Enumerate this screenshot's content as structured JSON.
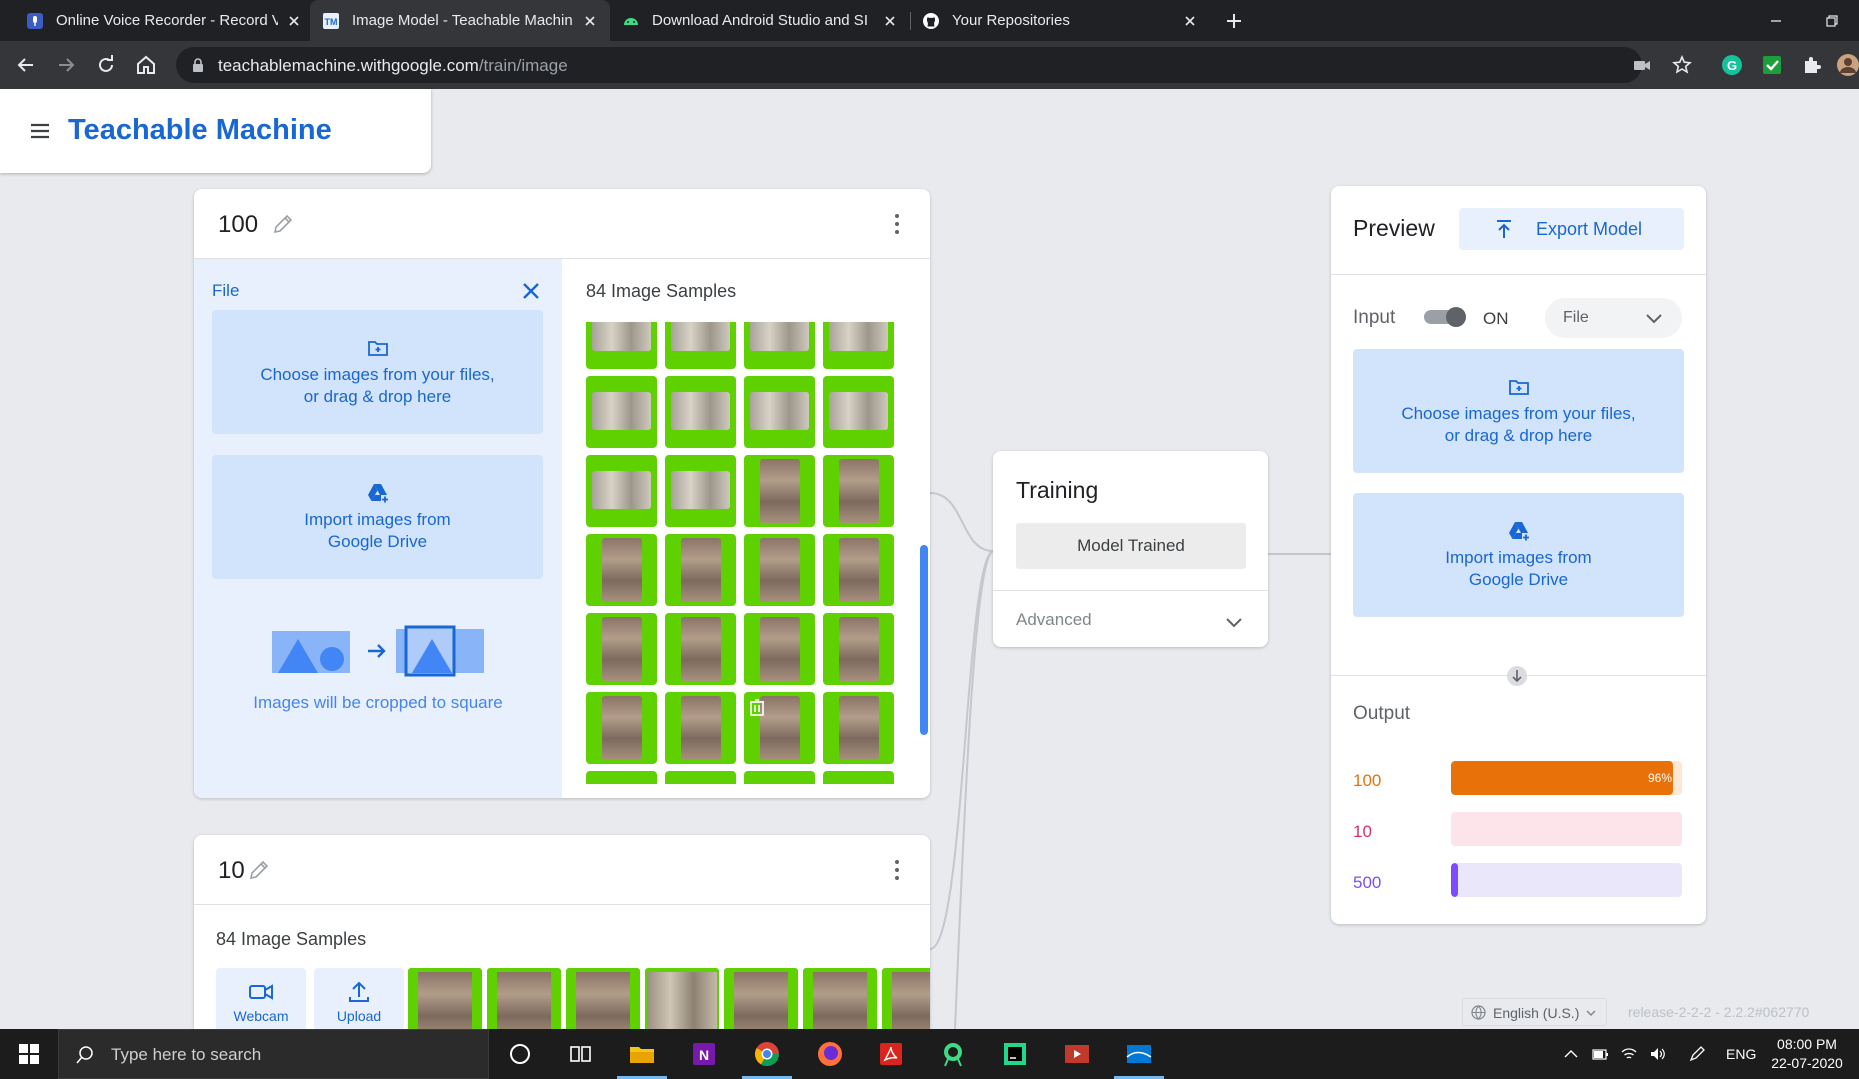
{
  "browser": {
    "tabs": [
      {
        "title": "Online Voice Recorder - Record V",
        "icon": "voice-recorder-icon",
        "color": "#3b5cc4"
      },
      {
        "title": "Image Model - Teachable Machin",
        "icon": "teachable-machine-icon",
        "color": "#4285f4",
        "active": true
      },
      {
        "title": "Download Android Studio and SI",
        "icon": "android-icon",
        "color": "#3ddc84"
      },
      {
        "title": "Your Repositories",
        "icon": "github-icon",
        "color": "#ffffff"
      }
    ],
    "url_host": "teachablemachine.withgoogle.com",
    "url_path": "/train/image"
  },
  "app": {
    "title": "Teachable Machine",
    "accent": "#1967d2"
  },
  "class1": {
    "name": "100",
    "upload_panel": {
      "label": "File",
      "choose_line1": "Choose images from your files,",
      "choose_line2": "or drag & drop here",
      "drive_line1": "Import images from",
      "drive_line2": "Google Drive",
      "crop_note": "Images will be cropped to square"
    },
    "samples_title": "84 Image Samples"
  },
  "class2": {
    "name": "10",
    "samples_title": "84 Image Samples",
    "webcam_label": "Webcam",
    "upload_label": "Upload"
  },
  "training": {
    "title": "Training",
    "button": "Model Trained",
    "advanced": "Advanced"
  },
  "preview": {
    "title": "Preview",
    "export_label": "Export Model",
    "input_label": "Input",
    "toggle_state": "ON",
    "input_source": "File",
    "choose_line1": "Choose images from your files,",
    "choose_line2": "or drag & drop here",
    "drive_line1": "Import images from",
    "drive_line2": "Google Drive",
    "output_label": "Output",
    "outputs": [
      {
        "label": "100",
        "percent": 96,
        "percent_text": "96%",
        "color": "#e8710a",
        "track": "#fde8d6"
      },
      {
        "label": "10",
        "percent": 0,
        "percent_text": "",
        "color": "#d93072",
        "track": "#fde4ea"
      },
      {
        "label": "500",
        "percent": 3,
        "percent_text": "",
        "color": "#7c4dff",
        "track": "#ebe7fb"
      }
    ]
  },
  "footer": {
    "language": "English (U.S.)",
    "release": "release-2-2-2 - 2.2.2#062770"
  },
  "taskbar": {
    "search_placeholder": "Type here to search",
    "lang": "ENG",
    "time": "08:00 PM",
    "date": "22-07-2020"
  }
}
